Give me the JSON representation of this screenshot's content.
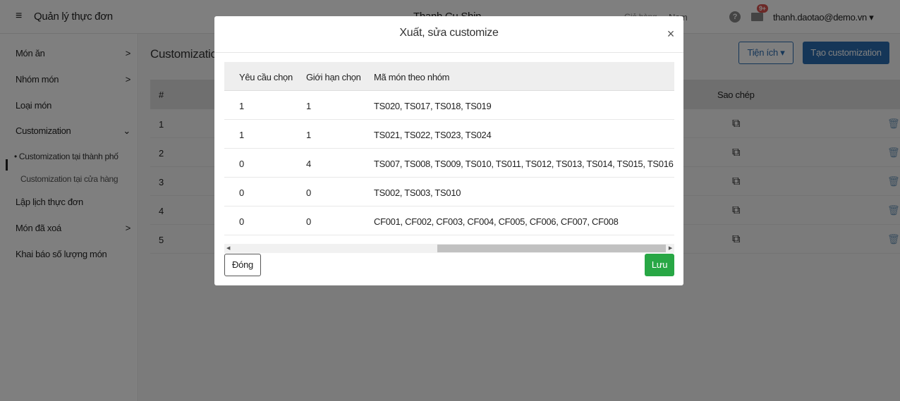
{
  "header": {
    "menu_icon": "hamburger-icon",
    "app_title": "Quản lý thực đơn",
    "shop_name": "Thanh Cu Shin",
    "cart_label": "Giỏ hàng",
    "city": "Nam",
    "notification_badge": "9+",
    "user": "thanh.daotao@demo.vn"
  },
  "sidebar": {
    "items": [
      {
        "label": "Món ăn",
        "chevron": ">"
      },
      {
        "label": "Nhóm món",
        "chevron": ">"
      },
      {
        "label": "Loại món"
      },
      {
        "label": "Customization",
        "chevron": "⌄"
      },
      {
        "label": "• Customization tại thành phố"
      },
      {
        "label": "Customization tại cửa hàng"
      },
      {
        "label": "Lập lịch thực đơn"
      },
      {
        "label": "Món đã xoá",
        "chevron": ">"
      },
      {
        "label": "Khai báo số lượng món"
      }
    ]
  },
  "main": {
    "title": "Customization",
    "util_button": "Tiện ích ▾",
    "create_button": "Tạo customization",
    "table": {
      "hash": "#",
      "copy_header": "Sao chép",
      "rows": [
        "1",
        "2",
        "3",
        "4",
        "5"
      ]
    }
  },
  "modal": {
    "title": "Xuất, sửa customize",
    "close": "×",
    "columns": [
      "Yêu cầu chọn",
      "Giới hạn chọn",
      "Mã món theo nhóm"
    ],
    "rows": [
      [
        "1",
        "1",
        "TS020, TS017, TS018, TS019"
      ],
      [
        "1",
        "1",
        "TS021, TS022, TS023, TS024"
      ],
      [
        "0",
        "4",
        "TS007, TS008, TS009, TS010, TS011, TS012, TS013, TS014, TS015, TS016"
      ],
      [
        "0",
        "0",
        "TS002, TS003, TS010"
      ],
      [
        "0",
        "0",
        "CF001, CF002, CF003, CF004, CF005, CF006, CF007, CF008"
      ]
    ],
    "close_button": "Đóng",
    "save_button": "Lưu",
    "scroll_position_percent": 100
  },
  "colors": {
    "primary": "#2b6cb0",
    "success": "#28a745",
    "badge": "#d9534f"
  }
}
